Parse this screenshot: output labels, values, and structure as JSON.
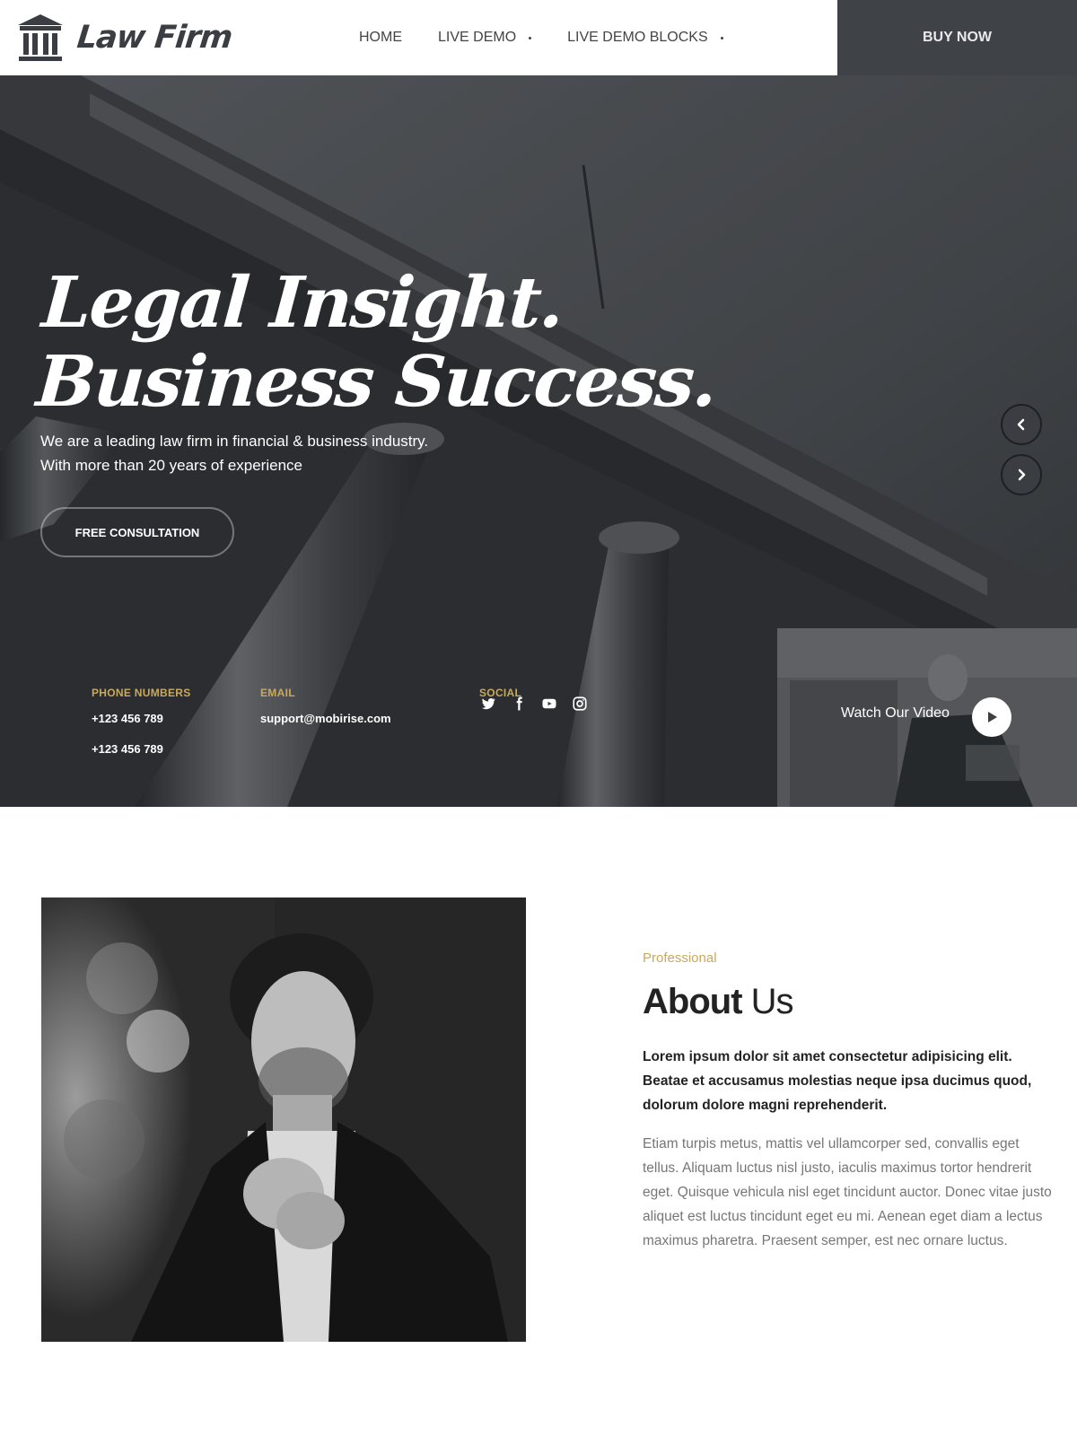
{
  "header": {
    "logo_text": "Law Firm",
    "nav": [
      {
        "label": "HOME",
        "has_dropdown": false
      },
      {
        "label": "LIVE DEMO",
        "has_dropdown": true
      },
      {
        "label": "LIVE DEMO BLOCKS",
        "has_dropdown": true
      }
    ],
    "buy_label": "BUY NOW"
  },
  "hero": {
    "title_line1": "Legal Insight.",
    "title_line2": "Business Success.",
    "subtitle_line1": "We are a leading law firm in financial & business industry.",
    "subtitle_line2": "With more than 20 years of experience",
    "cta_label": "FREE CONSULTATION",
    "contacts": {
      "phone_label": "PHONE NUMBERS",
      "phone_1": "+123 456 789",
      "phone_2": "+123 456 789",
      "email_label": "EMAIL",
      "email": "support@mobirise.com",
      "social_label": "SOCIAL",
      "social_icons": [
        "twitter-icon",
        "facebook-icon",
        "youtube-icon",
        "instagram-icon"
      ]
    },
    "video_label": "Watch Our Video",
    "slider_controls": [
      "chevron-left-icon",
      "chevron-right-icon"
    ]
  },
  "about": {
    "kicker": "Professional",
    "title_bold": "About",
    "title_light": "Us",
    "lead": "Lorem ipsum dolor sit amet consectetur adipisicing elit. Beatae et accusamus molestias neque ipsa ducimus quod, dolorum dolore magni reprehenderit.",
    "body": "Etiam turpis metus, mattis vel ullamcorper sed, convallis eget tellus. Aliquam luctus nisl justo, iaculis maximus tortor hendrerit eget. Quisque vehicula nisl eget tincidunt auctor. Donec vitae justo aliquet est luctus tincidunt eget eu mi. Aenean eget diam a lectus maximus pharetra. Praesent semper, est nec ornare luctus."
  },
  "colors": {
    "accent_gold": "#c9a95a",
    "dark": "#3f4247",
    "text": "#232323",
    "muted": "#767676"
  }
}
